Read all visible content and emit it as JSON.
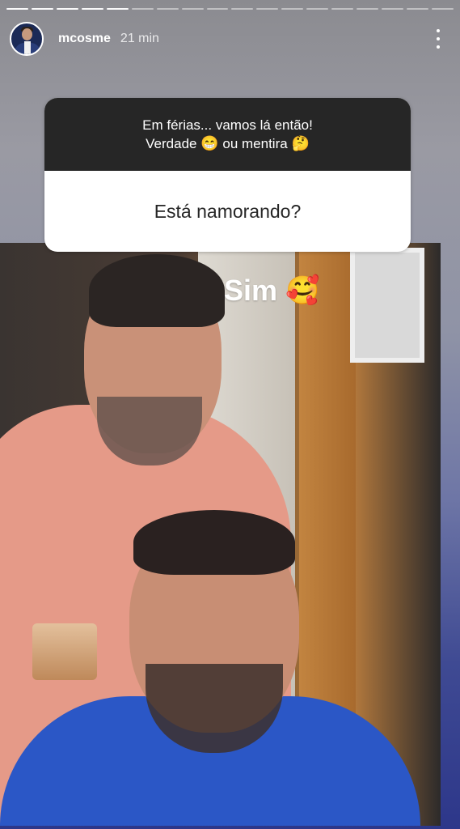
{
  "progress": {
    "total": 18,
    "completed": 5
  },
  "header": {
    "username": "mcosme",
    "time": "21 min",
    "more_icon": "more-vertical-icon"
  },
  "question_card": {
    "prompt_line1": "Em férias... vamos lá então!",
    "prompt_line2_a": "Verdade",
    "prompt_line2_b": "ou mentira",
    "emoji_grin": "😁",
    "emoji_thinking": "🤔",
    "question": "Está namorando?"
  },
  "answer": {
    "text": "Sim",
    "emoji": "🥰"
  }
}
